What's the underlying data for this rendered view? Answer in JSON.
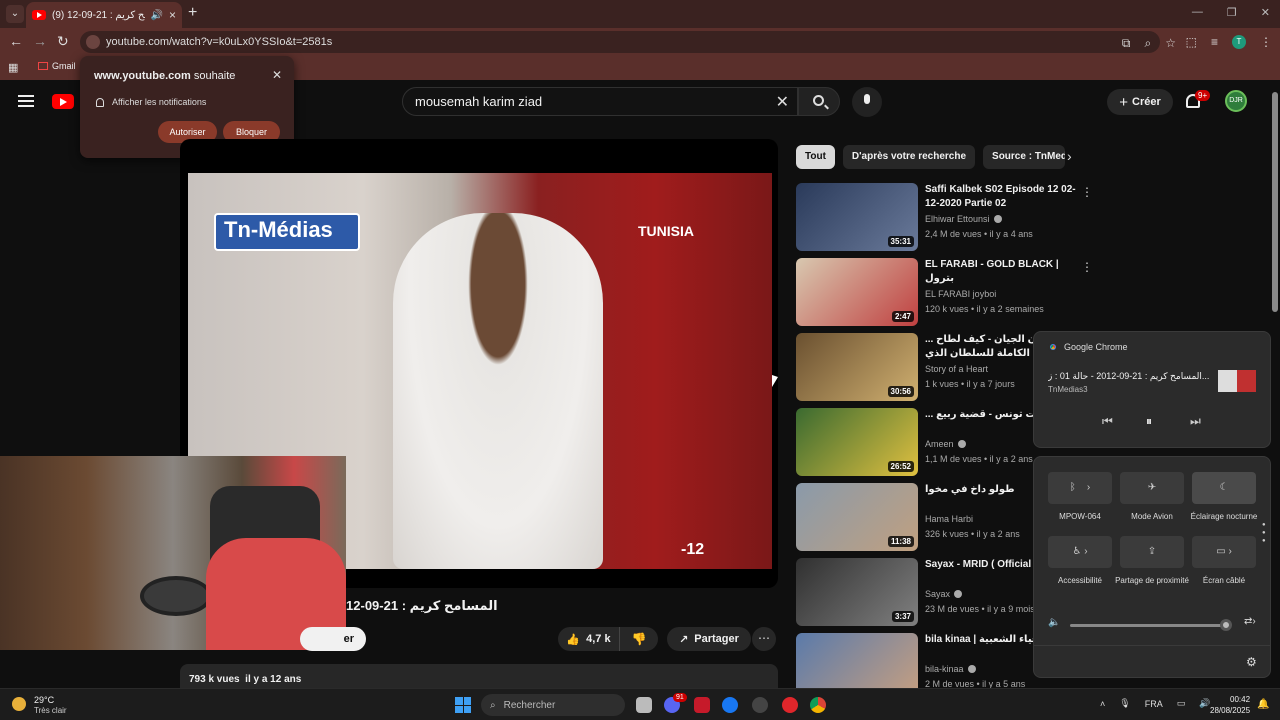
{
  "browser": {
    "tab_title": "المسامح كريم : 21-09-12 (9)",
    "url": "youtube.com/watch?v=k0uLx0YSSIo&t=2581s",
    "bookmark_gmail": "Gmail",
    "profile_initial": "T"
  },
  "notification_popup": {
    "site": "www.youtube.com",
    "site_suffix": "souhaite",
    "message": "Afficher les notifications",
    "allow_label": "Autoriser",
    "block_label": "Bloquer"
  },
  "header": {
    "search_query": "mousemah karim ziad",
    "create_label": "Créer",
    "notif_count": "9+",
    "avatar_text": "DJR"
  },
  "player": {
    "channel_watermark": "Tn-Médias",
    "station_logo": "TUNISIA",
    "corner_number": "-12"
  },
  "video": {
    "title": "المسامح كريم : 21-09-12",
    "subscribe_fragment": "er",
    "likes": "4,7 k",
    "share_label": "Partager",
    "views": "793 k vues",
    "age": "il y a 12 ans"
  },
  "chips": [
    "Tout",
    "D'après votre recherche",
    "Source : TnMedias3"
  ],
  "related": [
    {
      "title": "Saffi Kalbek S02 Episode 12 02-12-2020 Partie 02",
      "channel": "Elhiwar Ettounsi",
      "verified": true,
      "meta": "2,4 M de vues • il y a 4 ans",
      "duration": "35:31",
      "colors": [
        "#2a3a5a",
        "#6a7a9a"
      ]
    },
    {
      "title": "EL FARABI - GOLD BLACK | بترول",
      "channel": "EL FARABI joyboi",
      "verified": false,
      "meta": "120 k vues • il y a 2 semaines",
      "duration": "2:47",
      "colors": [
        "#d8c8b0",
        "#c04040"
      ]
    },
    {
      "title": "و السلطان الجيان - كيف لطاح ... القصة الكاملة للسلطان الذي",
      "channel": "Story of a Heart",
      "verified": false,
      "meta": "1 k vues • il y a 7 jours",
      "duration": "30:56",
      "colors": [
        "#6a5030",
        "#d0b070"
      ]
    },
    {
      "title": "... هزت تونس - قضية ربيع",
      "channel": "Ameen",
      "verified": true,
      "meta": "1,1 M de vues • il y a 2 ans",
      "duration": "26:52",
      "colors": [
        "#3a6a30",
        "#e0c040"
      ]
    },
    {
      "title": "طولو داخ في مخوا",
      "channel": "Hama Harbi",
      "verified": false,
      "meta": "326 k vues • il y a 2 ans",
      "duration": "11:38",
      "colors": [
        "#8a9aaa",
        "#c0a080"
      ]
    },
    {
      "title": "Sayax - MRID ( Official clip )",
      "channel": "Sayax",
      "verified": true,
      "meta": "23 M de vues • il y a 9 mois",
      "duration": "3:37",
      "colors": [
        "#303030",
        "#808080"
      ]
    },
    {
      "title": "bila kinaa | الأحياء الشعبية",
      "channel": "bila-kinaa",
      "verified": true,
      "meta": "2 M de vues • il y a 5 ans",
      "duration": "",
      "colors": [
        "#5a7aaa",
        "#c8a080"
      ]
    }
  ],
  "media_card": {
    "app": "Google Chrome",
    "title": "المسامح كريم : 21-09-2012 - حالة 01 : ز...",
    "artist": "TnMedias3"
  },
  "quick_settings": {
    "tiles": [
      {
        "label": "MPOW-064",
        "icon": "bluetooth-icon"
      },
      {
        "label": "Mode Avion",
        "icon": "airplane-icon"
      },
      {
        "label": "Éclairage nocturne",
        "icon": "night-light-icon"
      },
      {
        "label": "Accessibilité",
        "icon": "accessibility-icon"
      },
      {
        "label": "Partage de proximité",
        "icon": "nearby-share-icon"
      },
      {
        "label": "Écran câblé",
        "icon": "cast-icon"
      }
    ]
  },
  "taskbar": {
    "temperature": "29°C",
    "weather": "Très clair",
    "search_placeholder": "Rechercher",
    "language": "FRA",
    "time": "00:42",
    "date": "28/08/2025",
    "discord_badge": "91"
  }
}
